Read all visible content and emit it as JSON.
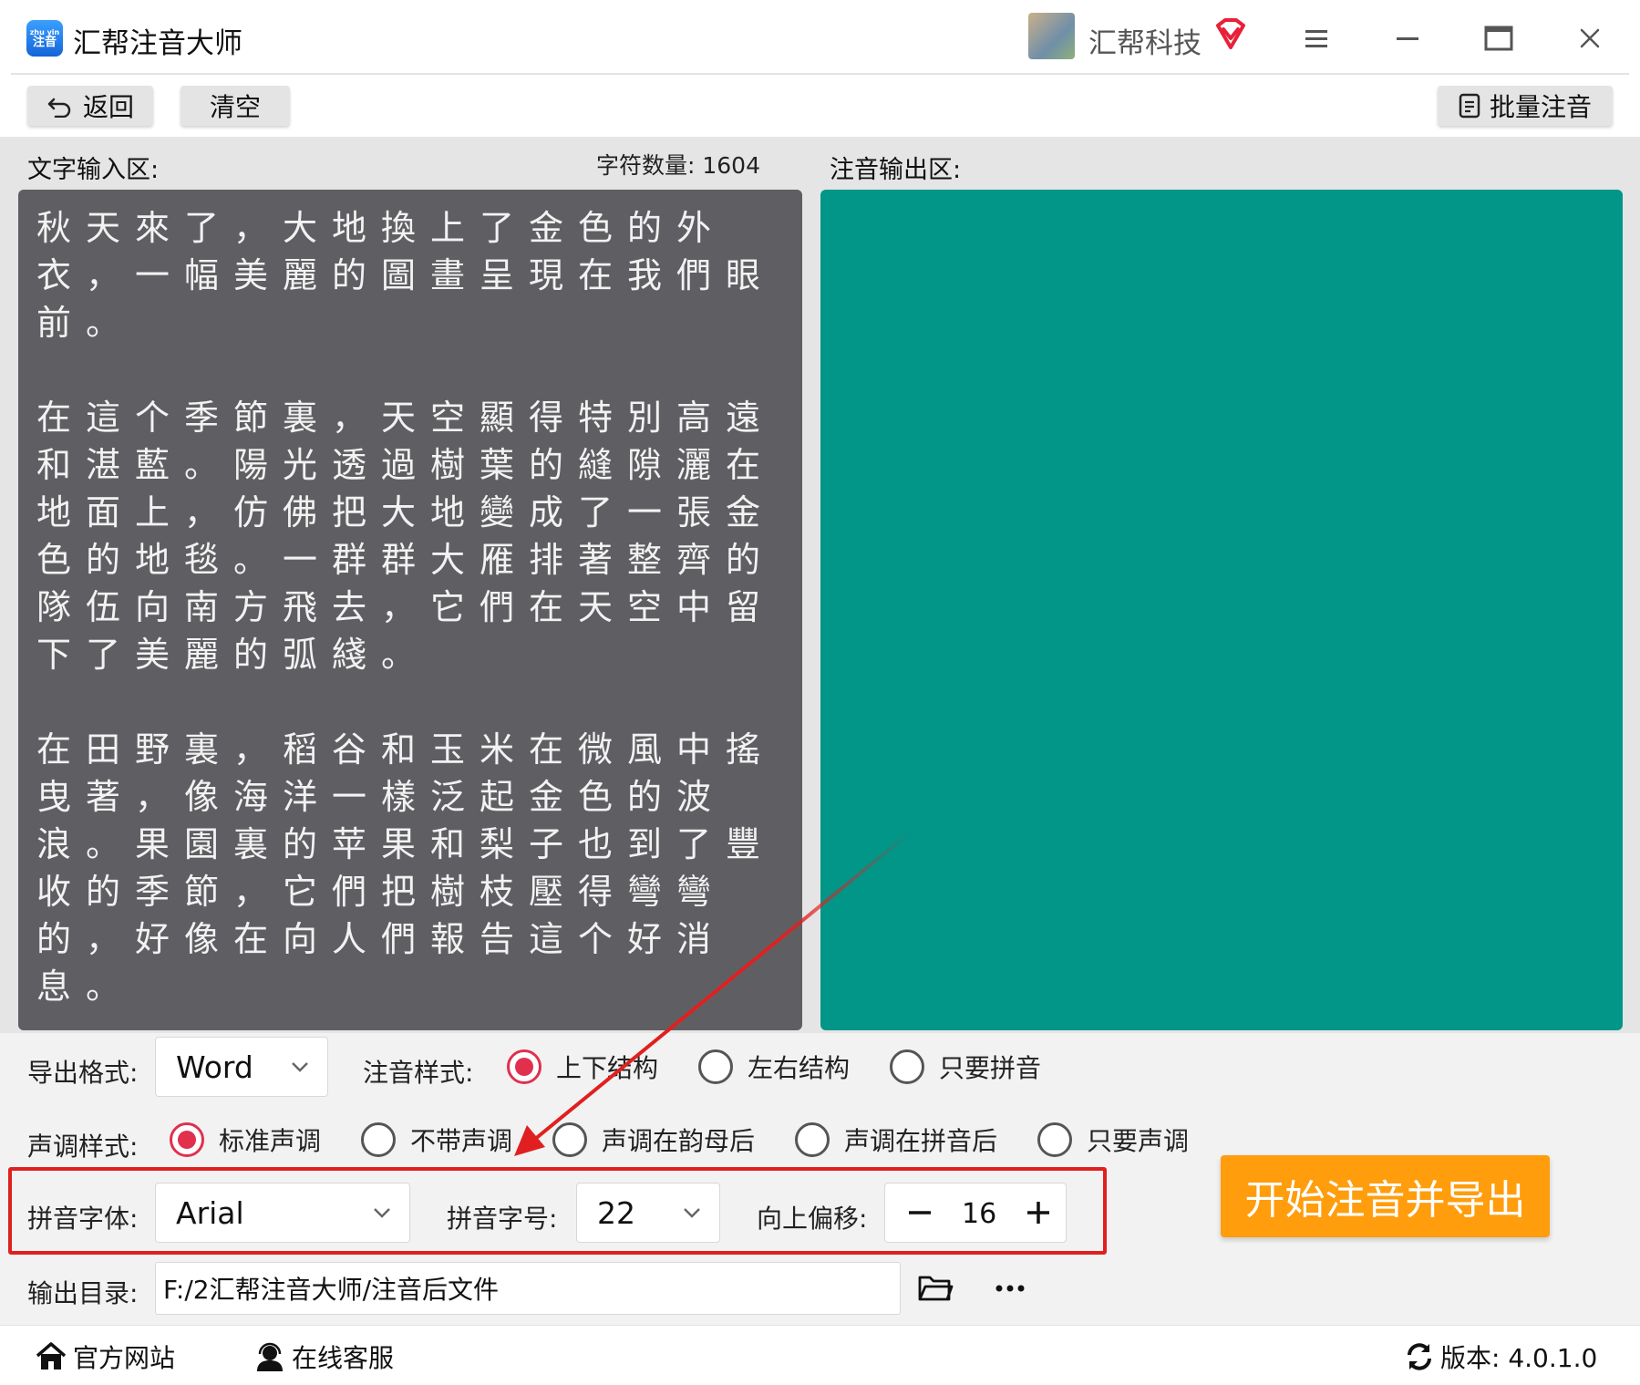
{
  "app": {
    "title": "汇帮注音大师",
    "logo_text_top": "zhu yin",
    "logo_text_bottom": "注音",
    "user_name": "汇帮科技"
  },
  "toolbar": {
    "back_label": "返回",
    "clear_label": "清空",
    "batch_label": "批量注音"
  },
  "input_area": {
    "label": "文字输入区:",
    "char_count": "字符数量: 1604",
    "text": "秋天來了，大地換上了金色的外衣，一幅美麗的圖畫呈現在我們眼前。\n\n在這个季節裏，天空顯得特別高遠和湛藍。陽光透過樹葉的縫隙灑在地面上，仿佛把大地變成了一張金色的地毯。一群群大雁排著整齊的隊伍向南方飛去，它們在天空中留下了美麗的弧綫。\n\n在田野裏，稻谷和玉米在微風中搖曳著，像海洋一樣泛起金色的波浪。果園裏的苹果和梨子也到了豐收的季節，它們把樹枝壓得彎彎的，好像在向人們報告這个好消息。"
  },
  "output_area": {
    "label": "注音输出区:"
  },
  "settings": {
    "export_format_label": "导出格式:",
    "export_format_value": "Word",
    "annotation_style_label": "注音样式:",
    "annotation_styles": [
      "上下结构",
      "左右结构",
      "只要拼音"
    ],
    "tone_style_label": "声调样式:",
    "tone_styles": [
      "标准声调",
      "不带声调",
      "声调在韵母后",
      "声调在拼音后",
      "只要声调"
    ],
    "pinyin_font_label": "拼音字体:",
    "pinyin_font_value": "Arial",
    "pinyin_size_label": "拼音字号:",
    "pinyin_size_value": "22",
    "offset_label": "向上偏移:",
    "offset_value": "16",
    "start_label": "开始注音并导出",
    "output_dir_label": "输出目录:",
    "output_dir_value": "F:/2汇帮注音大师/注音后文件"
  },
  "footer": {
    "website_label": "官方网站",
    "service_label": "在线客服",
    "version_label": "版本: 4.0.1.0"
  },
  "colors": {
    "input_bg": "#5f5f63",
    "output_bg": "#019688",
    "accent_red": "#e0304e",
    "start_orange": "#ff9d0d",
    "highlight_red": "#e02020"
  }
}
